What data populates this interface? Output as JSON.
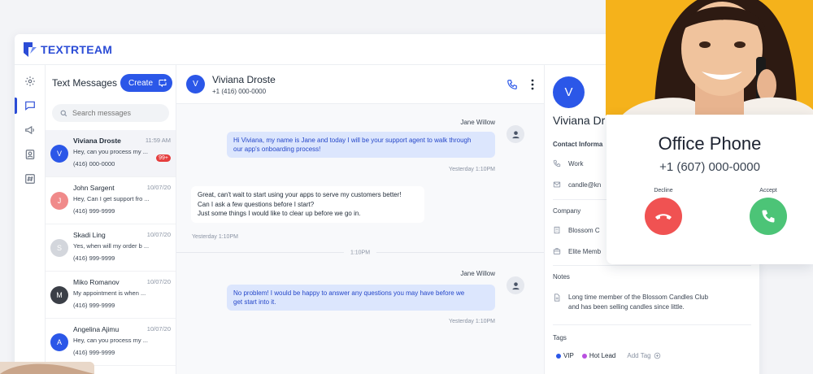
{
  "brand": {
    "name": "TEXTRTEAM",
    "color": "#2b4cd6"
  },
  "rail": {
    "items": [
      "gear-icon",
      "messages-icon",
      "megaphone-icon",
      "contacts-icon",
      "hashtag-icon"
    ],
    "active": "messages-icon"
  },
  "list": {
    "title": "Text Messages",
    "create_label": "Create",
    "search_placeholder": "Search messages",
    "conversations": [
      {
        "initial": "V",
        "name": "Viviana Droste",
        "time": "11:59 AM",
        "preview": "Hey, can you process my ...",
        "phone": "(416) 000-0000",
        "badge": "99+",
        "color": "#2b57e8"
      },
      {
        "initial": "J",
        "name": "John Sargent",
        "time": "10/07/20",
        "preview": "Hey, Can I get support fro ...",
        "phone": "(416) 999-9999",
        "color": "#f08a8a"
      },
      {
        "initial": "S",
        "name": "Skadi Ling",
        "time": "10/07/20",
        "preview": "Yes, when will my order b ...",
        "phone": "(416) 999-9999",
        "color": "#d3d6dc"
      },
      {
        "initial": "M",
        "name": "Miko Romanov",
        "time": "10/07/20",
        "preview": "My appointment is when ...",
        "phone": "(416) 999-9999",
        "color": "#3b3f47"
      },
      {
        "initial": "A",
        "name": "Angelina Ajimu",
        "time": "10/07/20",
        "preview": "Hey, can you process my ...",
        "phone": "(416) 999-9999",
        "color": "#2b57e8"
      }
    ]
  },
  "chat": {
    "contact_initial": "V",
    "contact_name": "Viviana Droste",
    "contact_phone": "+1 (416) 000-0000",
    "messages": [
      {
        "sender": "Jane Willow",
        "text_1": "Hi Viviana, my name is Jane and today I will be your support agent to walk through",
        "text_2": "our app's onboarding process!",
        "time": "Yesterday 1:10PM"
      },
      {
        "text_1": "Great, can't wait to start using your apps to serve my customers better!",
        "text_2": "Can I ask a few questions before I start?",
        "text_3": "Just some things I would like to clear up before we go in.",
        "time": "Yesterday 1:10PM"
      },
      {
        "sender": "Jane Willow",
        "text_1": "No problem! I would be happy to answer any questions you may have before we",
        "text_2": "get start into it.",
        "time": "Yesterday 1:10PM"
      }
    ],
    "divider": "1:10PM"
  },
  "details": {
    "initial": "V",
    "name": "Viviana Dr",
    "contact_section": "Contact Informa",
    "phone_label": "Work",
    "email": "candle@kn",
    "company_section": "Company",
    "company_name": "Blossom C",
    "membership": "Elite Memb",
    "notes_section": "Notes",
    "note_1": "Long time member of the Blossom Candles Club",
    "note_2": "and has been selling candles since little.",
    "tags_section": "Tags",
    "tags": [
      {
        "label": "VIP",
        "color": "#2b57e8"
      },
      {
        "label": "Hot Lead",
        "color": "#b94fe0"
      }
    ],
    "add_tag": "Add Tag"
  },
  "call": {
    "title": "Office Phone",
    "number": "+1 (607) 000-0000",
    "decline": "Decline",
    "accept": "Accept",
    "decline_color": "#f05252",
    "accept_color": "#4cc477"
  }
}
